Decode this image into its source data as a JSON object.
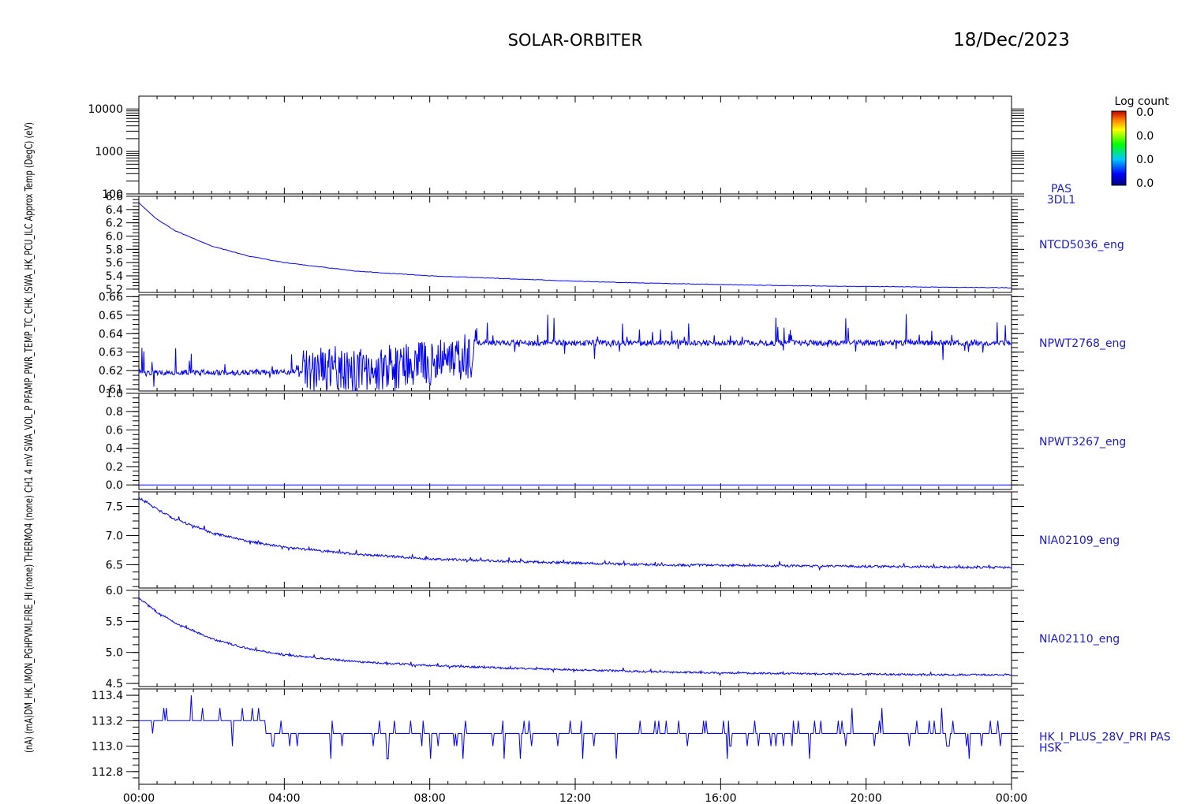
{
  "header": {
    "title": "SOLAR-ORBITER",
    "date": "18/Dec/2023"
  },
  "colors": {
    "axis": "#000000",
    "data": "#0000ff",
    "label": "#1c1cc8"
  },
  "colorbar": {
    "title": "Log count",
    "ticks": [
      "0.0",
      "0.0",
      "0.0",
      "0.0"
    ]
  },
  "shared_ylabel": "(nA) (mA)DM_HK_IMON_PGHPVMLFIRE_HI (none) THERMO4 (none) CH1 4 mV SWA_VOL_P PFAMP_PWR_TEMP_TC_CHK_ISWA_HK_PCU_ILC Approx Temp (DegC) (eV)",
  "chart_data": [
    {
      "type": "heatmap",
      "yscale": "log",
      "ylim": [
        100,
        20000
      ],
      "yticks": [
        100,
        1000,
        10000
      ],
      "ytick_labels": [
        "100",
        "1000",
        "10000"
      ],
      "right_label": [
        "PAS",
        "3DL1"
      ],
      "values": []
    },
    {
      "type": "line",
      "ylim": [
        5.15,
        6.6
      ],
      "yticks": [
        5.2,
        5.4,
        5.6,
        5.8,
        6.0,
        6.2,
        6.4,
        6.6
      ],
      "ytick_labels": [
        "5.2",
        "5.4",
        "5.6",
        "5.8",
        "6.0",
        "6.2",
        "6.4",
        "6.6"
      ],
      "right_label": [
        "NTCD5036_eng"
      ],
      "series": [
        {
          "x": [
            0,
            0.5,
            1,
            2,
            3,
            4,
            6,
            8,
            10,
            12,
            14,
            16,
            18,
            20,
            22,
            24
          ],
          "y": [
            6.5,
            6.25,
            6.08,
            5.85,
            5.7,
            5.6,
            5.47,
            5.4,
            5.36,
            5.32,
            5.29,
            5.27,
            5.25,
            5.24,
            5.23,
            5.22
          ]
        }
      ]
    },
    {
      "type": "line",
      "ylim": [
        0.609,
        0.661
      ],
      "yticks": [
        0.61,
        0.62,
        0.63,
        0.64,
        0.65,
        0.66
      ],
      "ytick_labels": [
        "0.61",
        "0.62",
        "0.63",
        "0.64",
        "0.65",
        "0.66"
      ],
      "right_label": [
        "NPWT2768_eng"
      ],
      "series": [
        {
          "x": [
            0,
            3,
            6,
            8,
            9.2,
            9.3,
            12,
            16,
            20,
            24
          ],
          "y": [
            0.619,
            0.619,
            0.62,
            0.624,
            0.628,
            0.635,
            0.635,
            0.635,
            0.635,
            0.635
          ]
        }
      ]
    },
    {
      "type": "line",
      "ylim": [
        -0.05,
        1.0
      ],
      "yticks": [
        0.0,
        0.2,
        0.4,
        0.6,
        0.8,
        1.0
      ],
      "ytick_labels": [
        "0.0",
        "0.2",
        "0.4",
        "0.6",
        "0.8",
        "1.0"
      ],
      "right_label": [
        "NPWT3267_eng"
      ],
      "series": [
        {
          "x": [
            0,
            24
          ],
          "y": [
            0.0,
            0.0
          ]
        }
      ]
    },
    {
      "type": "line",
      "ylim": [
        6.1,
        7.75
      ],
      "yticks": [
        6.0,
        6.5,
        7.0,
        7.5
      ],
      "ytick_labels": [
        "6.0",
        "6.5",
        "7.0",
        "7.5"
      ],
      "right_label": [
        "NIA02109_eng"
      ],
      "series": [
        {
          "x": [
            0,
            0.5,
            1,
            2,
            3,
            4,
            6,
            8,
            10,
            12,
            14,
            16,
            18,
            20,
            22,
            24
          ],
          "y": [
            7.65,
            7.45,
            7.28,
            7.05,
            6.9,
            6.8,
            6.68,
            6.6,
            6.56,
            6.53,
            6.5,
            6.49,
            6.48,
            6.47,
            6.46,
            6.45
          ]
        }
      ]
    },
    {
      "type": "line",
      "ylim": [
        4.45,
        6.0
      ],
      "yticks": [
        4.5,
        5.0,
        5.5,
        6.0
      ],
      "ytick_labels": [
        "4.5",
        "5.0",
        "5.5",
        "6.0"
      ],
      "right_label": [
        "NIA02110_eng"
      ],
      "series": [
        {
          "x": [
            0,
            0.5,
            1,
            2,
            3,
            4,
            6,
            8,
            10,
            12,
            14,
            16,
            18,
            20,
            22,
            24
          ],
          "y": [
            5.88,
            5.65,
            5.48,
            5.22,
            5.06,
            4.96,
            4.85,
            4.79,
            4.75,
            4.72,
            4.69,
            4.67,
            4.66,
            4.65,
            4.64,
            4.64
          ]
        }
      ]
    },
    {
      "type": "line",
      "ylim": [
        112.7,
        113.45
      ],
      "yticks": [
        112.8,
        113.0,
        113.2,
        113.4
      ],
      "ytick_labels": [
        "112.8",
        "113.0",
        "113.2",
        "113.4"
      ],
      "right_label": [
        "HK_I_PLUS_28V_PRI PAS",
        "HSK"
      ],
      "series": [
        {
          "x": [
            0,
            3.5,
            3.6,
            10,
            12,
            16,
            20,
            24
          ],
          "y": [
            113.15,
            113.15,
            113.05,
            113.05,
            113.05,
            113.05,
            113.05,
            113.05
          ]
        }
      ]
    }
  ],
  "xaxis": {
    "range_hours": [
      0,
      24
    ],
    "ticks": [
      0,
      4,
      8,
      12,
      16,
      20,
      24
    ],
    "tick_labels": [
      "00:00",
      "04:00",
      "08:00",
      "12:00",
      "16:00",
      "20:00",
      "00:00"
    ]
  }
}
